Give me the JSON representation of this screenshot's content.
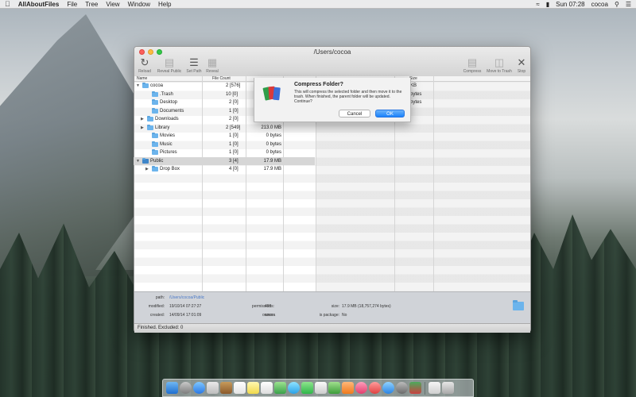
{
  "menubar": {
    "app_name": "AllAboutFiles",
    "items": [
      "File",
      "Tree",
      "View",
      "Window",
      "Help"
    ],
    "clock": "Sun 07:28",
    "user": "cocoa"
  },
  "window": {
    "title": "/Users/cocoa",
    "toolbar": {
      "reload": "Reload",
      "reveal": "Reveal Public",
      "set_path": "Set Path",
      "reveal2": "Reveal",
      "compress": "Compress",
      "move_trash": "Move to Trash",
      "stop": "Stop"
    },
    "columns": {
      "name": "Name",
      "file_count": "File Count",
      "size": "Size"
    },
    "rows": [
      {
        "name": "cocoa",
        "count": "2 [576]",
        "size": "",
        "rsize": "KB"
      },
      {
        "name": ".Trash",
        "count": "10 [0]",
        "size": "",
        "rsize": "bytes"
      },
      {
        "name": "Desktop",
        "count": "2 [0]",
        "size": "",
        "rsize": "bytes"
      },
      {
        "name": "Documents",
        "count": "1 [0]",
        "size": "",
        "rsize": ""
      },
      {
        "name": "Downloads",
        "count": "2 [0]",
        "size": "",
        "rsize": ""
      },
      {
        "name": "Library",
        "count": "2 [549]",
        "size": "213.0 MB",
        "rsize": ""
      },
      {
        "name": "Movies",
        "count": "1 [0]",
        "size": "0 bytes",
        "rsize": ""
      },
      {
        "name": "Music",
        "count": "1 [0]",
        "size": "0 bytes",
        "rsize": ""
      },
      {
        "name": "Pictures",
        "count": "1 [0]",
        "size": "0 bytes",
        "rsize": ""
      },
      {
        "name": "Public",
        "count": "3 [4]",
        "size": "17.9 MB",
        "rsize": ""
      },
      {
        "name": "Drop Box",
        "count": "4 [0]",
        "size": "17.9 MB",
        "rsize": ""
      }
    ],
    "info": {
      "path_label": "path:",
      "path_value": "/Users/cocoa/Public",
      "modified_label": "modified:",
      "modified_value": "19/10/14 07:27:27",
      "created_label": "created:",
      "created_value": "14/09/14 17:01:09",
      "permissions_label": "permissions:",
      "permissions_value": "493",
      "owner_label": "owner:",
      "owner_value": "cocoa",
      "size_label": "size:",
      "size_value": "17.9 MB   (18,757,274 bytes)",
      "package_label": "is package:",
      "package_value": "No"
    },
    "status": "Finished. Excluded: 0"
  },
  "dialog": {
    "title": "Compress Folder?",
    "message": "This will compress the selected folder and then move it to the trash. When finished, the parent folder will be updated. Continue?",
    "cancel": "Cancel",
    "ok": "OK"
  },
  "colors": {
    "accent": "#1a82fb",
    "folder": "#6cb4ec",
    "selected_row": "#d6d6d6"
  }
}
